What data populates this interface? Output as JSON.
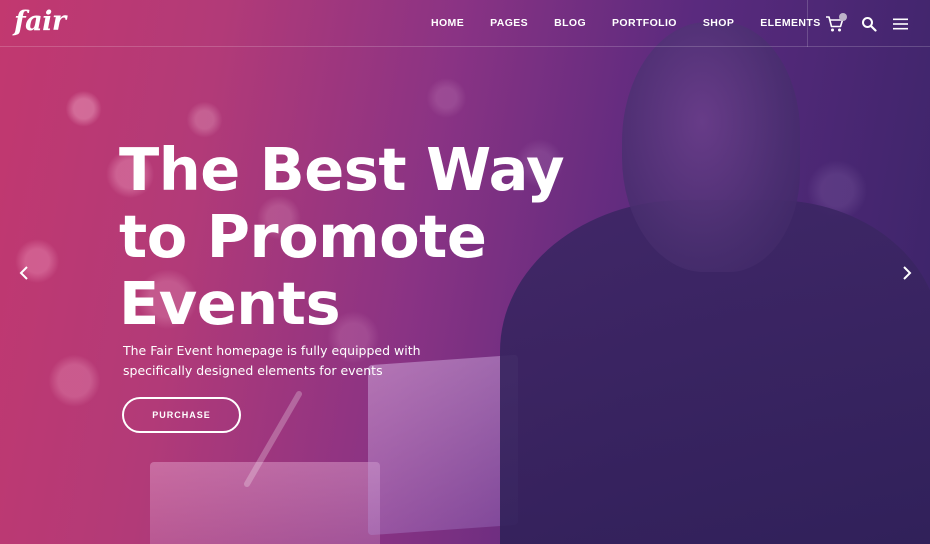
{
  "brand": {
    "logo_text": "fair"
  },
  "nav": {
    "items": [
      {
        "label": "HOME"
      },
      {
        "label": "PAGES"
      },
      {
        "label": "BLOG"
      },
      {
        "label": "PORTFOLIO"
      },
      {
        "label": "SHOP"
      },
      {
        "label": "ELEMENTS"
      }
    ],
    "icons": [
      "cart-icon",
      "search-icon",
      "hamburger-menu-icon"
    ]
  },
  "hero": {
    "headline_lines": [
      "The Best Way",
      "to Promote",
      "Events"
    ],
    "subtext_lines": [
      "The Fair Event homepage is fully equipped with",
      "specifically designed elements for events"
    ],
    "cta_label": "PURCHASE",
    "slider_arrows": [
      "chevron-left-icon",
      "chevron-right-icon"
    ]
  },
  "colors": {
    "gradient_start": "#c2386f",
    "gradient_end": "#3a2468",
    "text": "#ffffff"
  }
}
